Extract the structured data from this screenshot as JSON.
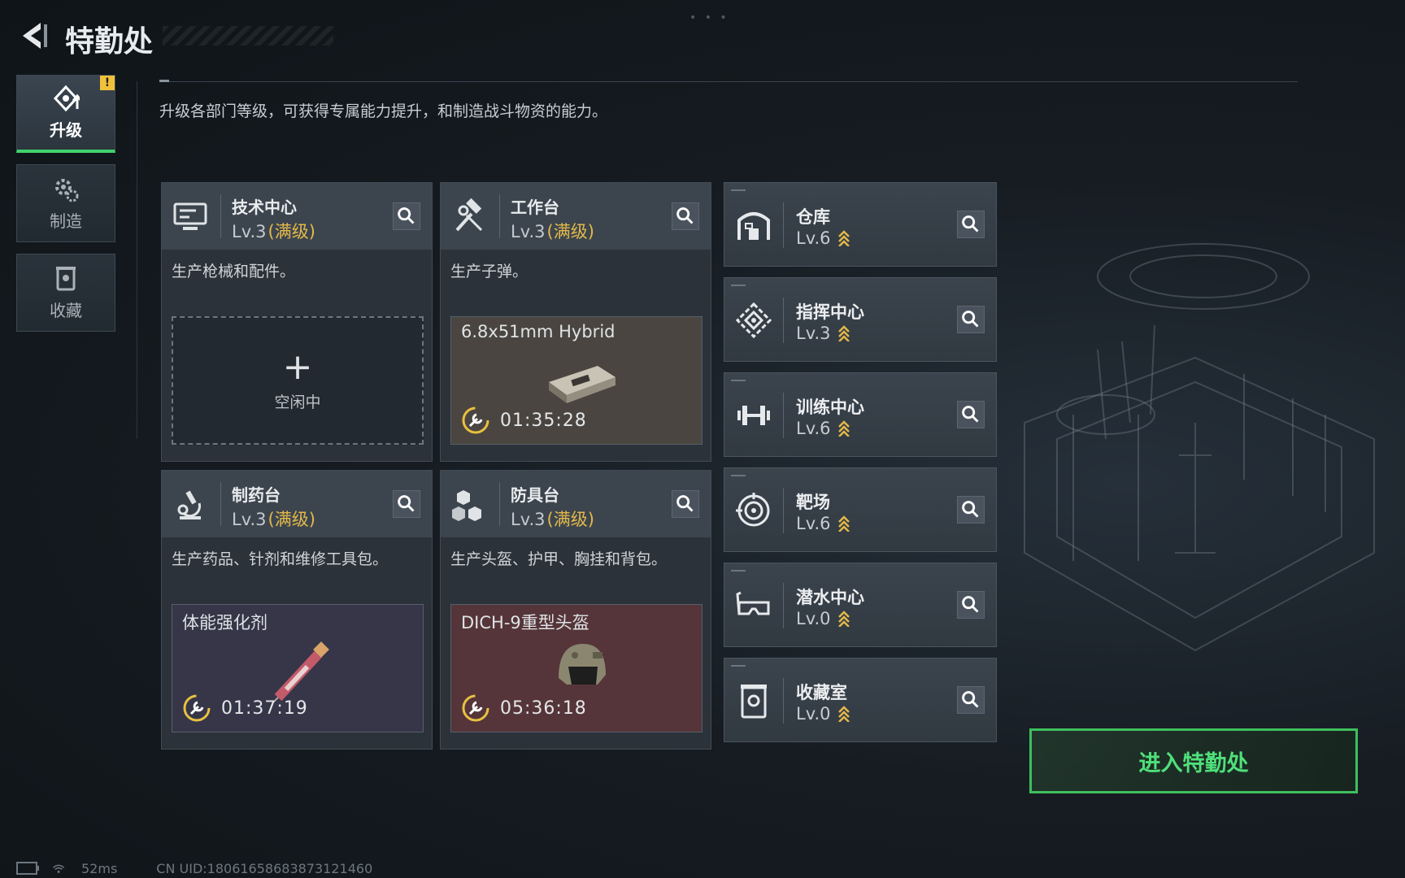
{
  "header": {
    "title": "特勤处"
  },
  "sidebar": {
    "items": [
      {
        "label": "升级",
        "active": true,
        "badge": "!"
      },
      {
        "label": "制造",
        "active": false
      },
      {
        "label": "收藏",
        "active": false
      }
    ]
  },
  "description": "升级各部门等级，可获得专属能力提升，和制造战斗物资的能力。",
  "workshops": [
    {
      "name": "技术中心",
      "level": "Lv.3",
      "max_label": "(满级)",
      "desc": "生产枪械和配件。",
      "idle_label": "空闲中",
      "icon": "monitor-icon"
    },
    {
      "name": "工作台",
      "level": "Lv.3",
      "max_label": "(满级)",
      "desc": "生产子弹。",
      "item": "6.8x51mm Hybrid",
      "timer": "01:35:28",
      "icon": "hammer-wrench-icon"
    },
    {
      "name": "制药台",
      "level": "Lv.3",
      "max_label": "(满级)",
      "desc": "生产药品、针剂和维修工具包。",
      "item": "体能强化剂",
      "timer": "01:37:19",
      "icon": "microscope-icon"
    },
    {
      "name": "防具台",
      "level": "Lv.3",
      "max_label": "(满级)",
      "desc": "生产头盔、护甲、胸挂和背包。",
      "item": "DICH-9重型头盔",
      "timer": "05:36:18",
      "icon": "blocks-icon"
    }
  ],
  "facilities": [
    {
      "name": "仓库",
      "level": "Lv.6",
      "icon": "warehouse-icon"
    },
    {
      "name": "指挥中心",
      "level": "Lv.3",
      "icon": "command-icon"
    },
    {
      "name": "训练中心",
      "level": "Lv.6",
      "icon": "dumbbell-icon"
    },
    {
      "name": "靶场",
      "level": "Lv.6",
      "icon": "target-icon"
    },
    {
      "name": "潜水中心",
      "level": "Lv.0",
      "icon": "diving-mask-icon"
    },
    {
      "name": "收藏室",
      "level": "Lv.0",
      "icon": "trophy-case-icon"
    }
  ],
  "enter_button": "进入特勤处",
  "status": {
    "ping": "52ms",
    "uid": "CN UID:18061658683873121460"
  },
  "colors": {
    "accent_green": "#3fd46b",
    "max_gold": "#e3b84a",
    "badge_yellow": "#f0c23a"
  }
}
